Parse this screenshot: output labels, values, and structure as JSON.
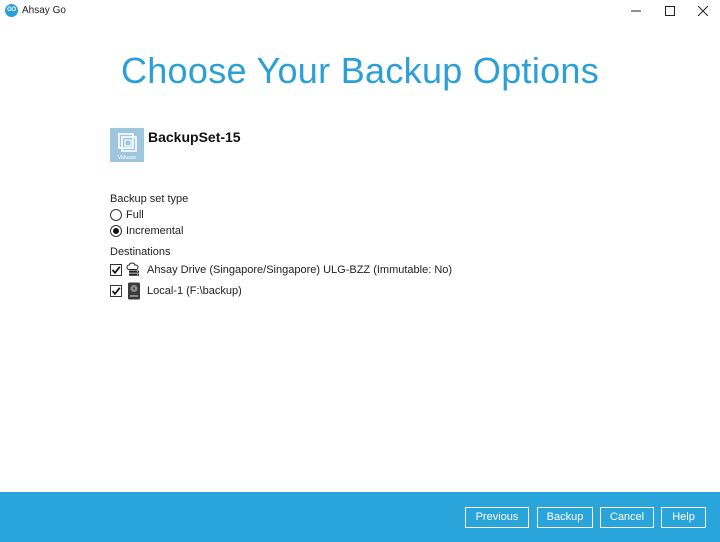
{
  "window": {
    "logo_text": "GO",
    "title": "Ahsay Go",
    "controls": [
      "minimize-icon",
      "maximize-icon",
      "close-icon"
    ]
  },
  "page": {
    "heading": "Choose Your Backup Options"
  },
  "backup_set": {
    "name": "BackupSet-15",
    "icon": "vmware-icon",
    "icon_label": "VMware"
  },
  "backup_type": {
    "label": "Backup set type",
    "options": [
      {
        "label": "Full",
        "selected": false
      },
      {
        "label": "Incremental",
        "selected": true
      }
    ]
  },
  "destinations": {
    "label": "Destinations",
    "items": [
      {
        "label": "Ahsay Drive (Singapore/Singapore) ULG-BZZ (Immutable: No)",
        "checked": true,
        "icon": "cloud-drive-icon"
      },
      {
        "label": "Local-1 (F:\\backup)",
        "checked": true,
        "icon": "local-drive-icon"
      }
    ]
  },
  "footer": {
    "previous_label": "Previous",
    "backup_label": "Backup",
    "cancel_label": "Cancel",
    "help_label": "Help"
  },
  "colors": {
    "accent": "#2a9fd8",
    "footer_bg": "#2aa5dc",
    "icon_tile": "#9ec6dd"
  }
}
